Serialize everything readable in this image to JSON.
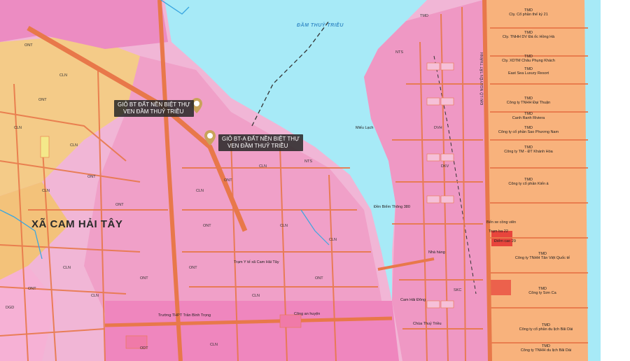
{
  "colors": {
    "land_base": "#f1b6d6",
    "residential": "#f0a0c8",
    "urban": "#ef86be",
    "rural_yellow": "#f4cb88",
    "orange": "#f5b06a",
    "water": "#a7eaf7",
    "road": "#e8784a",
    "salmon": "#f4a3a0",
    "resort": "#f8b27c",
    "red": "#e8453c",
    "tree_green": "#c8e6a8"
  },
  "callouts": [
    {
      "line1": "GIỎ BT ĐẤT NỀN BIỆT THỰ",
      "line2": "VEN ĐẦM THUỶ TRIỀU"
    },
    {
      "line1": "GIỎ BT-A ĐẤT NỀN BIỆT THỰ",
      "line2": "VEN ĐẦM THUỶ TRIỀU"
    }
  ],
  "labels": {
    "lagoon": "ĐẦM THUỶ TRIỀU",
    "ward": "XÃ CAM HẢI TÂY",
    "road_nguyen_tat_thanh": "ĐẠI LỘ NGUYỄN TẤT THÀNH",
    "cam_hai_dong": "Cam Hải Đông",
    "mieu_lach": "Miếu Lạch",
    "den_biem": "Đền Biểm Thông 380",
    "truong_thpt": "Trường THPT Trần Bình Trọng",
    "tram_ytb": "Trạm Y tế xã Cam Hải Tây",
    "cong_an": "Công an huyện",
    "nha_hang": "Nhà hàng",
    "ben_xe": "Bến xe cồng viên",
    "tram_bien": "Trạm ba 22",
    "diem_cao": "Điểm cao 29",
    "chua": "Chùa Thuỷ Triều"
  },
  "zone_tags": [
    "ONT",
    "CLN",
    "ONT",
    "CLN",
    "CLN",
    "ONT",
    "CLN",
    "ONT",
    "CLN",
    "ONT",
    "CLN",
    "ONT",
    "CLN",
    "CLN",
    "ONT",
    "NTS",
    "ONT",
    "CLN",
    "ONT",
    "CLN",
    "CLN",
    "ONT",
    "ODT",
    "CLN",
    "TMD",
    "DGD",
    "NTS",
    "SKC",
    "DVH",
    "DKV"
  ],
  "tmd_list": [
    {
      "code": "TMD",
      "name": "Cty. Cổ phần thế kỷ 21"
    },
    {
      "code": "TMD",
      "name": "Cty. TNHH DV Đá ốc Hồng Hà"
    },
    {
      "code": "TMD",
      "name": "Cty. XDTM Châu Phụng Khách"
    },
    {
      "code": "TMD",
      "name": "East Sea Luxury Resort"
    },
    {
      "code": "TMD",
      "name": "Công ty TNHH Đại Thuận"
    },
    {
      "code": "TMD",
      "name": "Canh Ranh Riviera"
    },
    {
      "code": "TMD",
      "name": "Công ty cổ phần Sao Phương Nam"
    },
    {
      "code": "TMD",
      "name": "Công ty TM - ĐT Khánh Hòa"
    },
    {
      "code": "TMD",
      "name": "Công ty cổ phần Kiến á"
    },
    {
      "code": "TMD",
      "name": "Công ty TNHH Tân Việt Quốc tế"
    },
    {
      "code": "TMD",
      "name": "Công ty Sơn Ca"
    },
    {
      "code": "TMD",
      "name": "Công ty cổ phần du lịch Bãi Dài"
    },
    {
      "code": "TMD",
      "name": "Công ty TNHH du lịch Bãi Dài"
    }
  ],
  "icons": [
    "map-pin-icon",
    "map-pin-icon"
  ]
}
